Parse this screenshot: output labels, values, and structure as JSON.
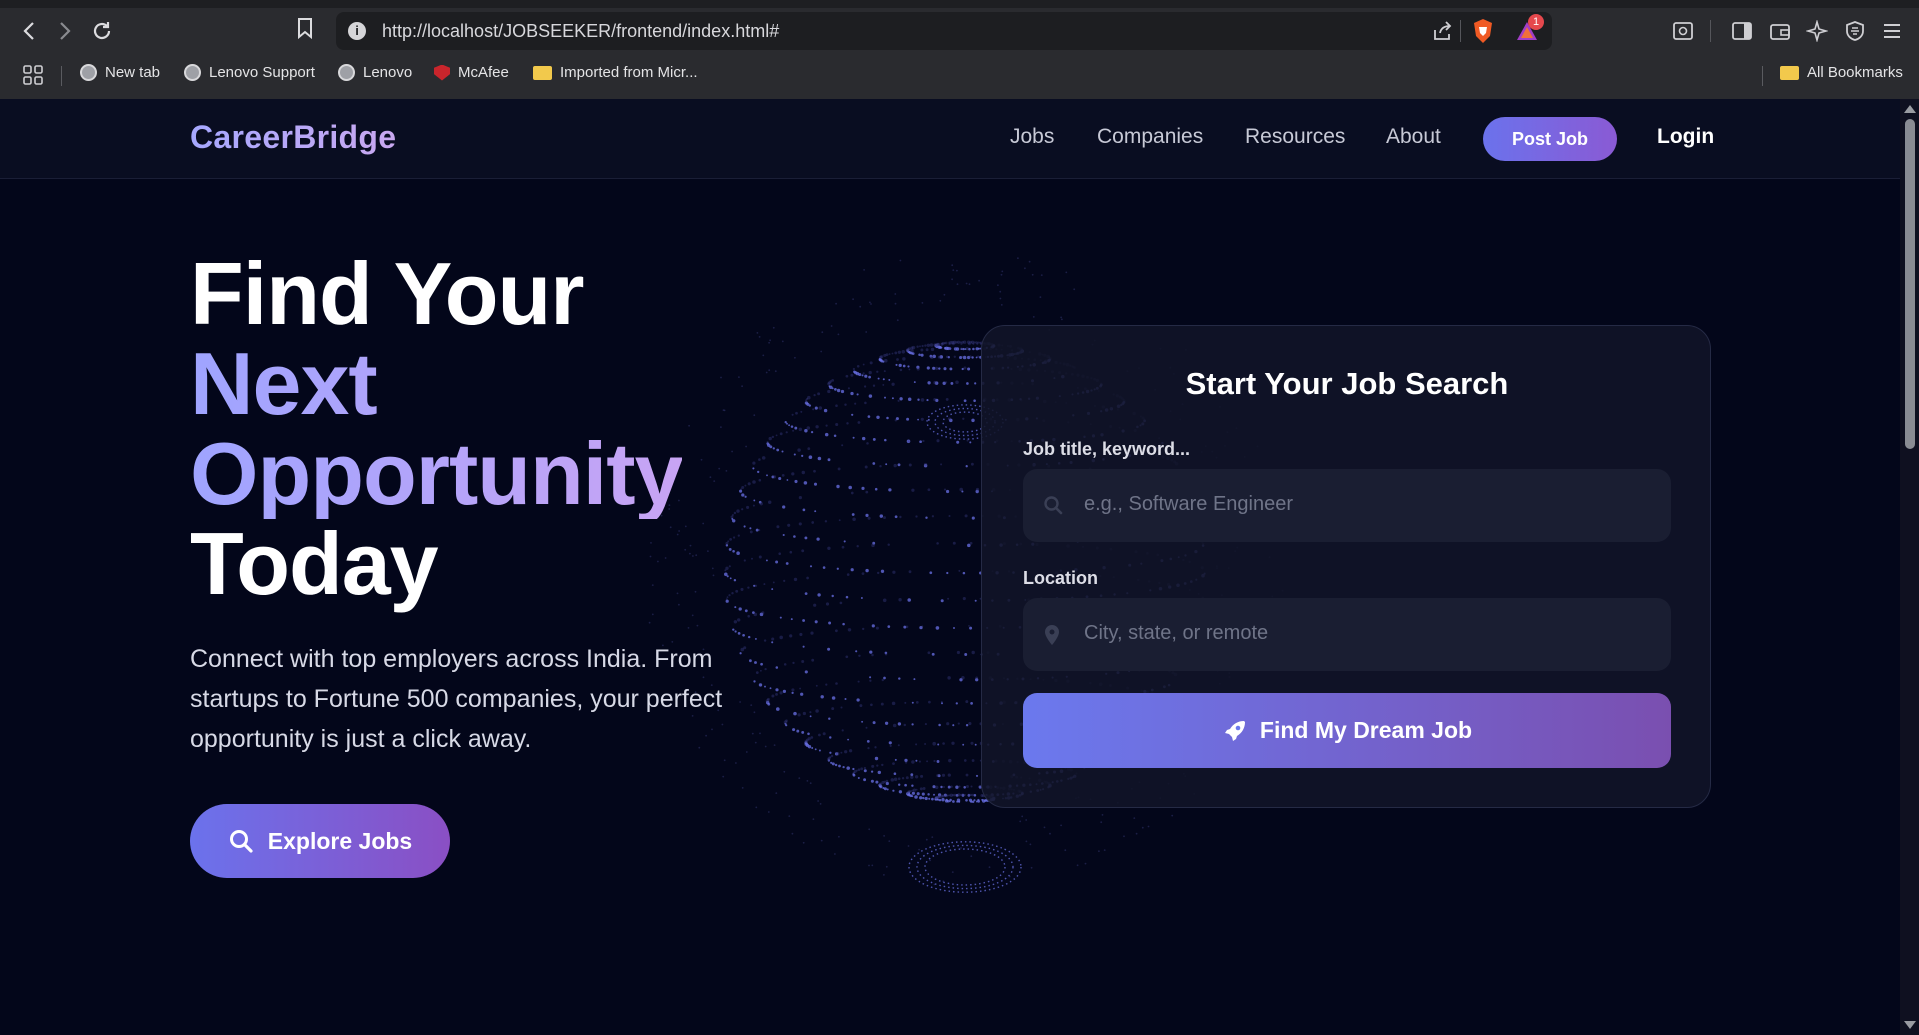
{
  "browser": {
    "url": "http://localhost/JOBSEEKER/frontend/index.html#",
    "bookmarks": [
      "New tab",
      "Lenovo Support",
      "Lenovo",
      "McAfee",
      "Imported from Micr..."
    ],
    "all_bookmarks": "All Bookmarks",
    "notification_count": "1"
  },
  "nav": {
    "logo": "CareerBridge",
    "links": [
      "Jobs",
      "Companies",
      "Resources",
      "About"
    ],
    "post_job": "Post Job",
    "login": "Login"
  },
  "hero": {
    "line1": "Find Your",
    "line2": "Next",
    "line3": "Opportunity",
    "line4": "Today",
    "subtitle": "Connect with top employers across India. From startups to Fortune 500 companies, your perfect opportunity is just a click away.",
    "cta": "Explore Jobs"
  },
  "search_card": {
    "title": "Start Your Job Search",
    "job_label": "Job title, keyword...",
    "job_placeholder": "e.g., Software Engineer",
    "location_label": "Location",
    "location_placeholder": "City, state, or remote",
    "submit": "Find My Dream Job"
  },
  "colors": {
    "background": "#03061a",
    "accent_start": "#6b72ec",
    "accent_end": "#8a5ad4",
    "card": "#111428"
  }
}
